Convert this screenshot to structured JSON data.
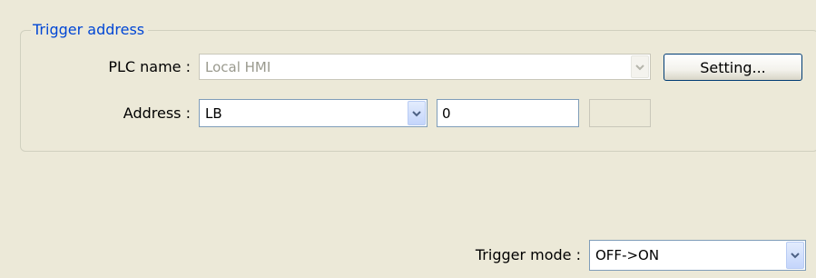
{
  "trigger_address": {
    "title": "Trigger address",
    "plc_name": {
      "label": "PLC name :",
      "value": "Local HMI",
      "setting_button": "Setting..."
    },
    "address": {
      "label": "Address :",
      "device_type": "LB",
      "address_value": "0",
      "extra_value": ""
    }
  },
  "trigger_mode": {
    "label": "Trigger mode :",
    "value": "OFF->ON"
  },
  "icons": {
    "dropdown": "chevron-down-icon"
  },
  "colors": {
    "background": "#ece9d8",
    "group_title": "#0046d5",
    "input_border": "#7f9db9"
  }
}
